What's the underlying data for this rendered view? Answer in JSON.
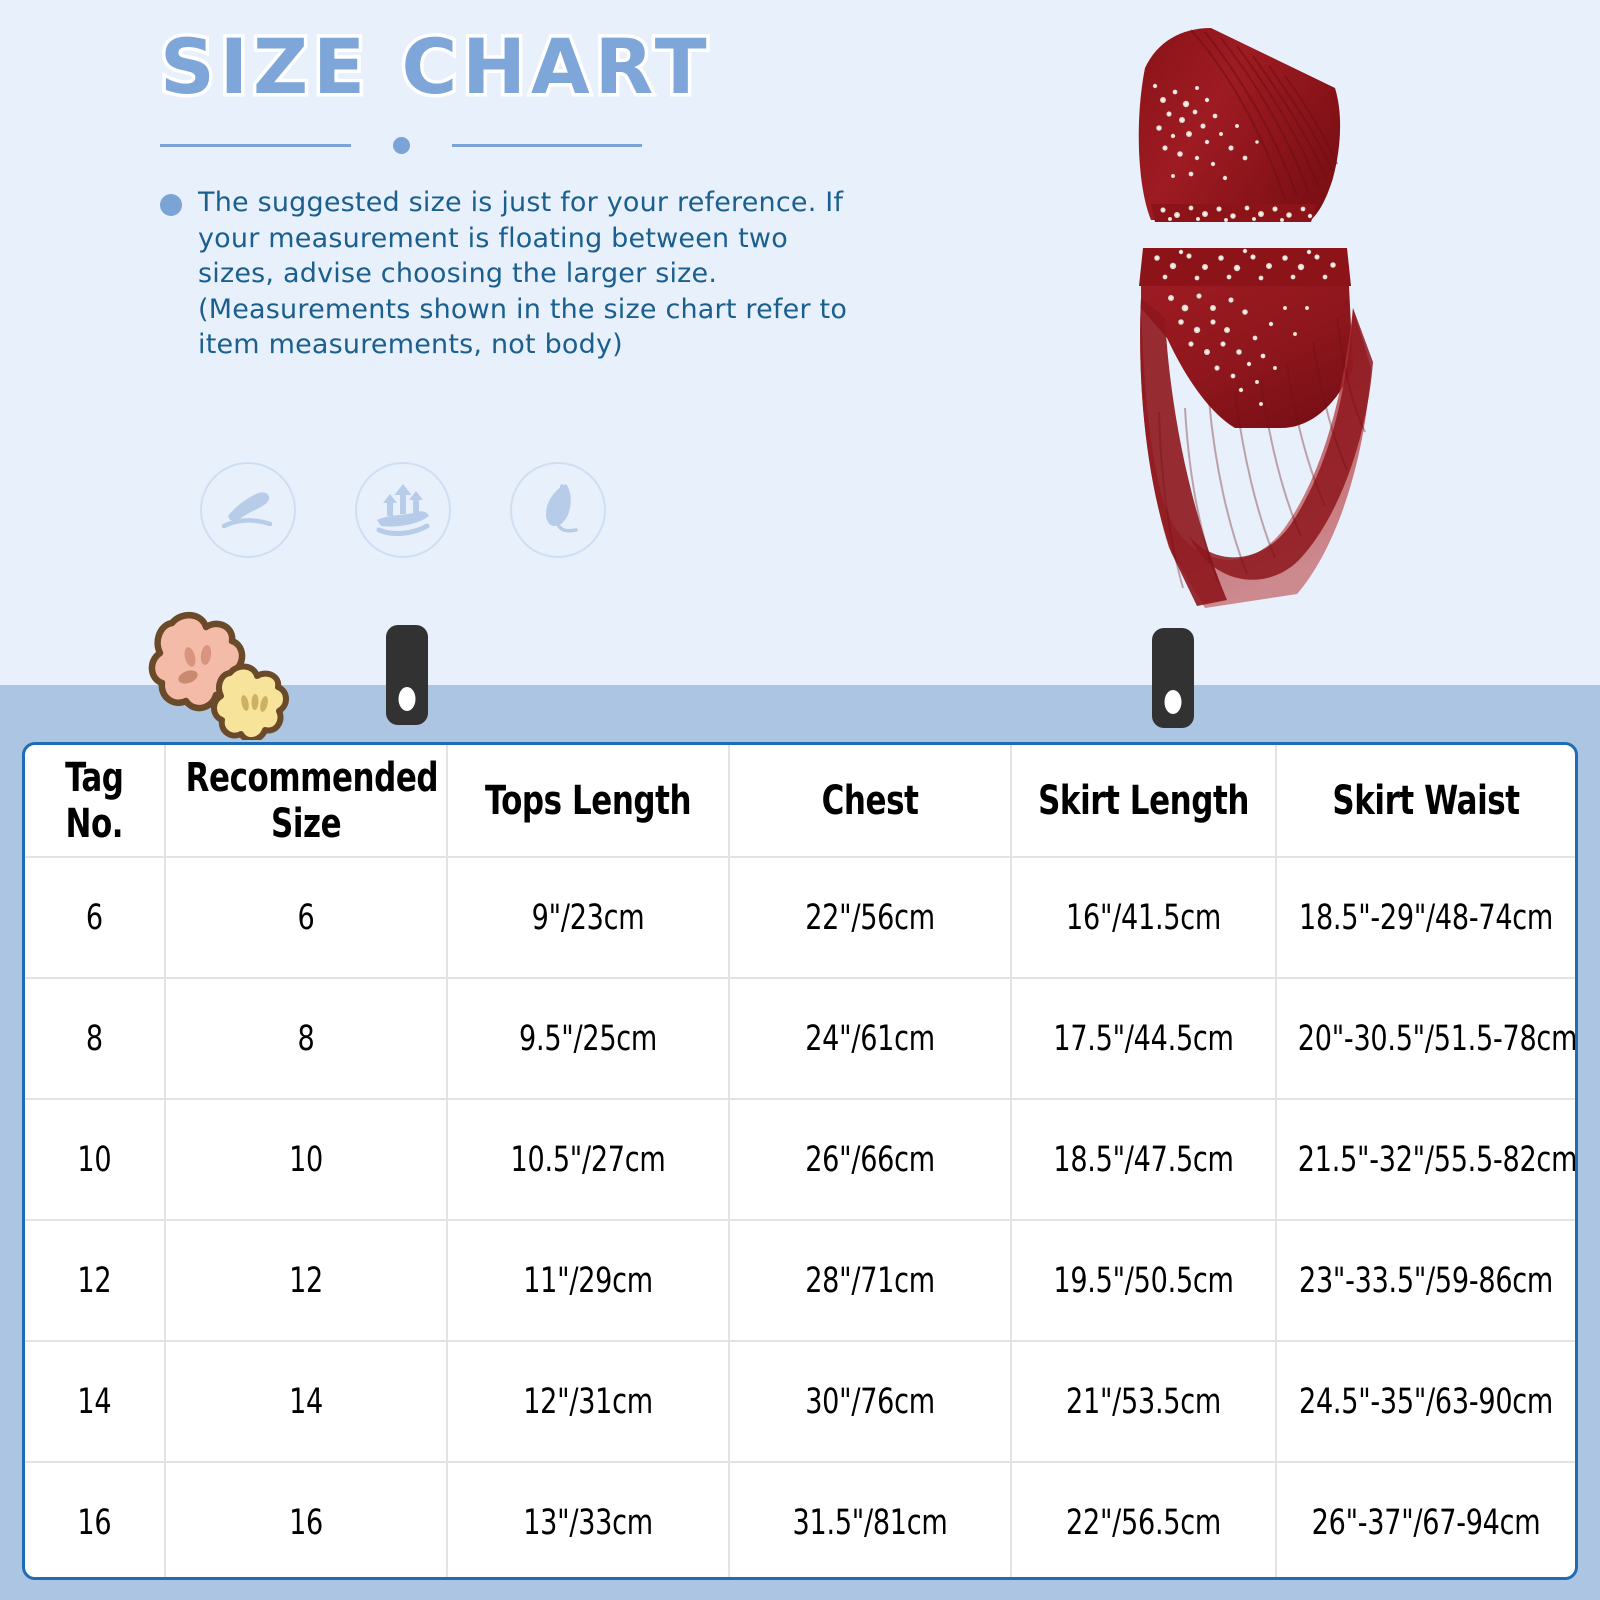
{
  "page": {
    "title": "SIZE CHART",
    "bg_top_color": "#e8f0fb",
    "bg_bottom_color": "#abc5e2",
    "accent_color": "#7ba3d6",
    "text_color": "#1a5f8e",
    "table_border_color": "#1f6cb5"
  },
  "note": {
    "bullet": "bullet-dot",
    "text": "The suggested size is just for your reference. If your measurement is floating between two sizes, advise  choosing the larger size.\n(Measurements shown in the size chart refer to item measurements, not body)"
  },
  "features": [
    {
      "name": "soft-touch-hand-icon",
      "label": "Soft Touch"
    },
    {
      "name": "breathable-icon",
      "label": "Breathable"
    },
    {
      "name": "lightweight-feather-icon",
      "label": "Lightweight"
    }
  ],
  "decorations": {
    "flower_large_color": "#f4bba8",
    "flower_small_color": "#f7e39a",
    "flower_outline_color": "#6b4a2a",
    "clip_color": "#323232",
    "clip_hole_color": "#ffffff"
  },
  "product": {
    "name": "red-rhinestone-dance-costume",
    "fabric_color": "#9e1b22",
    "mesh_color": "#b0262c",
    "rhinestone_color": "#f4f0ea"
  },
  "chart_data": {
    "type": "table",
    "title": "SIZE CHART",
    "columns": [
      "Tag No.",
      "Recommended Size",
      "Tops Length",
      "Chest",
      "Skirt Length",
      "Skirt Waist"
    ],
    "rows": [
      [
        "6",
        "6",
        "9\"/23cm",
        "22\"/56cm",
        "16\"/41.5cm",
        "18.5\"-29\"/48-74cm"
      ],
      [
        "8",
        "8",
        "9.5\"/25cm",
        "24\"/61cm",
        "17.5\"/44.5cm",
        "20\"-30.5\"/51.5-78cm"
      ],
      [
        "10",
        "10",
        "10.5\"/27cm",
        "26\"/66cm",
        "18.5\"/47.5cm",
        "21.5\"-32\"/55.5-82cm"
      ],
      [
        "12",
        "12",
        "11\"/29cm",
        "28\"/71cm",
        "19.5\"/50.5cm",
        "23\"-33.5\"/59-86cm"
      ],
      [
        "14",
        "14",
        "12\"/31cm",
        "30\"/76cm",
        "21\"/53.5cm",
        "24.5\"-35\"/63-90cm"
      ],
      [
        "16",
        "16",
        "13\"/33cm",
        "31.5\"/81cm",
        "22\"/56.5cm",
        "26\"-37\"/67-94cm"
      ]
    ]
  }
}
